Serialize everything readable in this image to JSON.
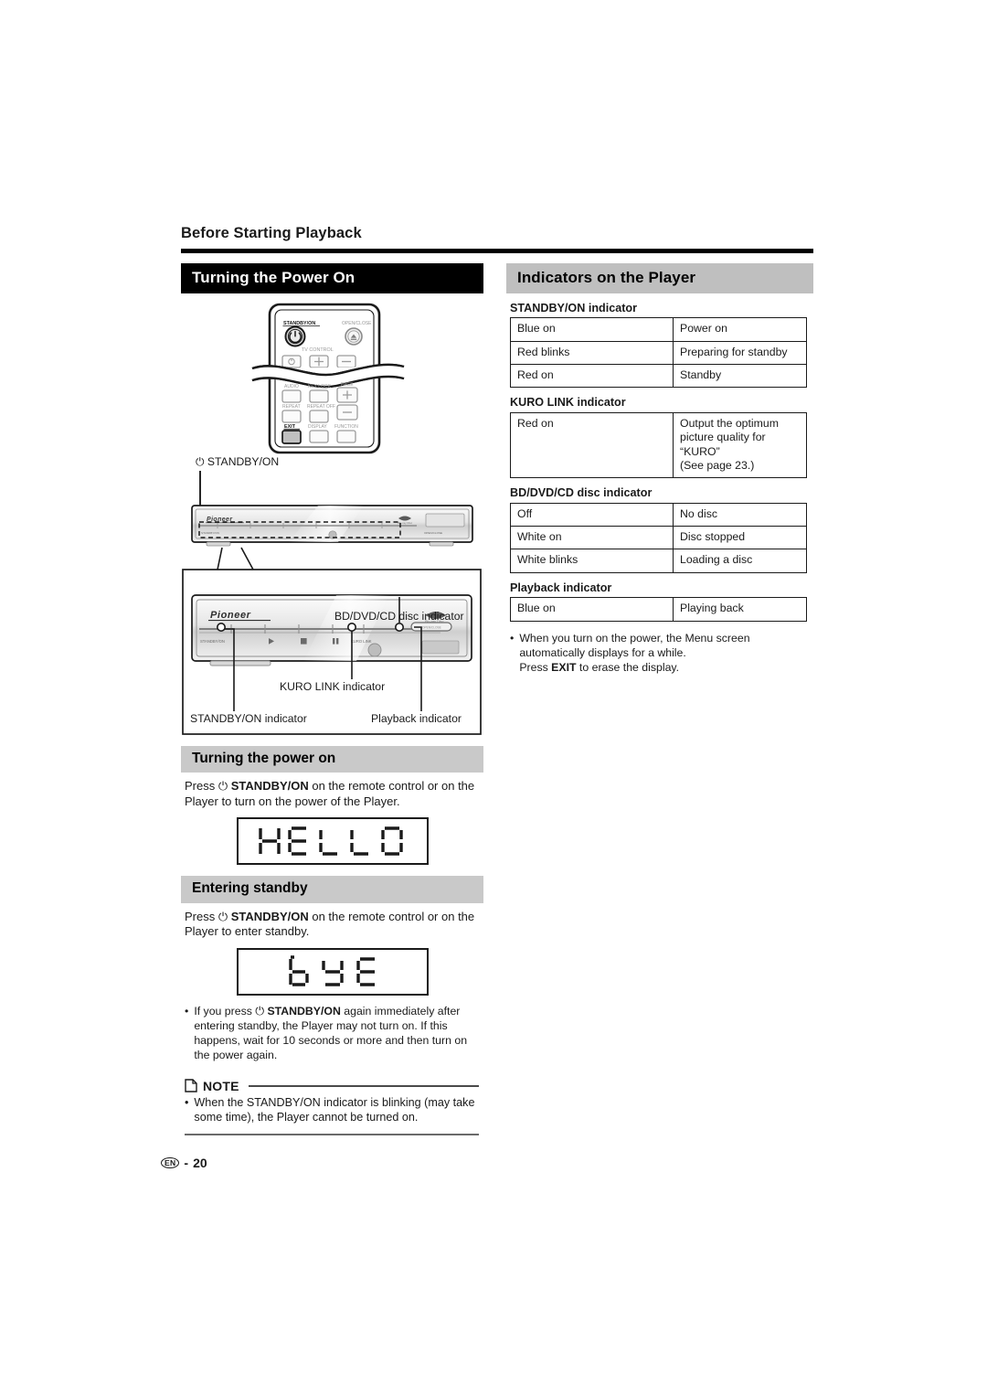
{
  "page": {
    "running_head": "Before Starting Playback",
    "page_number": "20",
    "language_code": "EN",
    "page_separator": "-"
  },
  "left_column": {
    "section_title": "Turning the Power On",
    "illustration": {
      "remote": {
        "buttons": [
          "STANDBY/ON",
          "OPEN/CLOSE",
          "TV CONTROL",
          "AUDIO",
          "KEY LOCK",
          "PAGE",
          "REPEAT",
          "REPEAT OFF",
          "EXIT",
          "DISPLAY",
          "FUNCTION"
        ],
        "tv_control_label": "TV CONTROL",
        "page_plus": "+",
        "page_minus": "–",
        "tv_plus": "+",
        "tv_minus": "–"
      },
      "player_callout": "STANDBY/ON",
      "front_panel_labels": {
        "standby_on": "STANDBY/ON",
        "kuro_link": "KURO LINK"
      },
      "detail_labels": {
        "disc_indicator": "BD/DVD/CD disc indicator",
        "kuro_link_indicator": "KURO LINK indicator",
        "standby_indicator": "STANDBY/ON indicator",
        "playback_indicator": "Playback indicator"
      },
      "brand": "Pioneer",
      "disc_logo": "Blu-ray Disc"
    },
    "power_on": {
      "subsection_title": "Turning the power on",
      "body_prefix": "Press ",
      "body_bold": "STANDBY/ON",
      "body_suffix": " on the remote control or on the Player to turn on the power of the Player.",
      "lcd_text": "HELLO"
    },
    "standby": {
      "subsection_title": "Entering standby",
      "body_prefix": "Press ",
      "body_bold": "STANDBY/ON",
      "body_suffix": " on the remote control or on the Player to enter standby.",
      "lcd_text": "BYE",
      "bullet_prefix": "If you press ",
      "bullet_bold": "STANDBY/ON",
      "bullet_suffix": " again immediately after entering standby, the Player may not turn on. If this happens, wait for 10 seconds or more and then turn on the power again."
    },
    "note": {
      "label": "NOTE",
      "icon": "note-page-icon",
      "bullet": "•",
      "text": "When the STANDBY/ON indicator is blinking (may take some time), the Player cannot be turned on."
    }
  },
  "right_column": {
    "section_title": "Indicators on the Player",
    "tables": [
      {
        "title": "STANDBY/ON indicator",
        "rows": [
          [
            "Blue on",
            "Power on"
          ],
          [
            "Red blinks",
            "Preparing for standby"
          ],
          [
            "Red on",
            "Standby"
          ]
        ]
      },
      {
        "title": "KURO LINK indicator",
        "rows": [
          [
            "Red on",
            "Output the optimum picture quality for “KURO”\n(See page 23.)"
          ]
        ]
      },
      {
        "title": "BD/DVD/CD disc indicator",
        "rows": [
          [
            "Off",
            "No disc"
          ],
          [
            "White on",
            "Disc stopped"
          ],
          [
            "White blinks",
            "Loading a disc"
          ]
        ]
      },
      {
        "title": "Playback indicator",
        "rows": [
          [
            "Blue on",
            "Playing back"
          ]
        ]
      }
    ],
    "note_bullet": {
      "dot": "•",
      "line1": "When you turn on the power, the Menu screen",
      "line2": "automatically displays for a while.",
      "line3_prefix": "Press ",
      "line3_bold": "EXIT",
      "line3_suffix": " to erase the display."
    }
  },
  "colors": {
    "section_bar_black": "#000000",
    "section_bar_gray": "#bfbfbf",
    "subsection_bar_gray": "#c9c9c9",
    "rule": "#000000",
    "text": "#1a1a1a"
  }
}
